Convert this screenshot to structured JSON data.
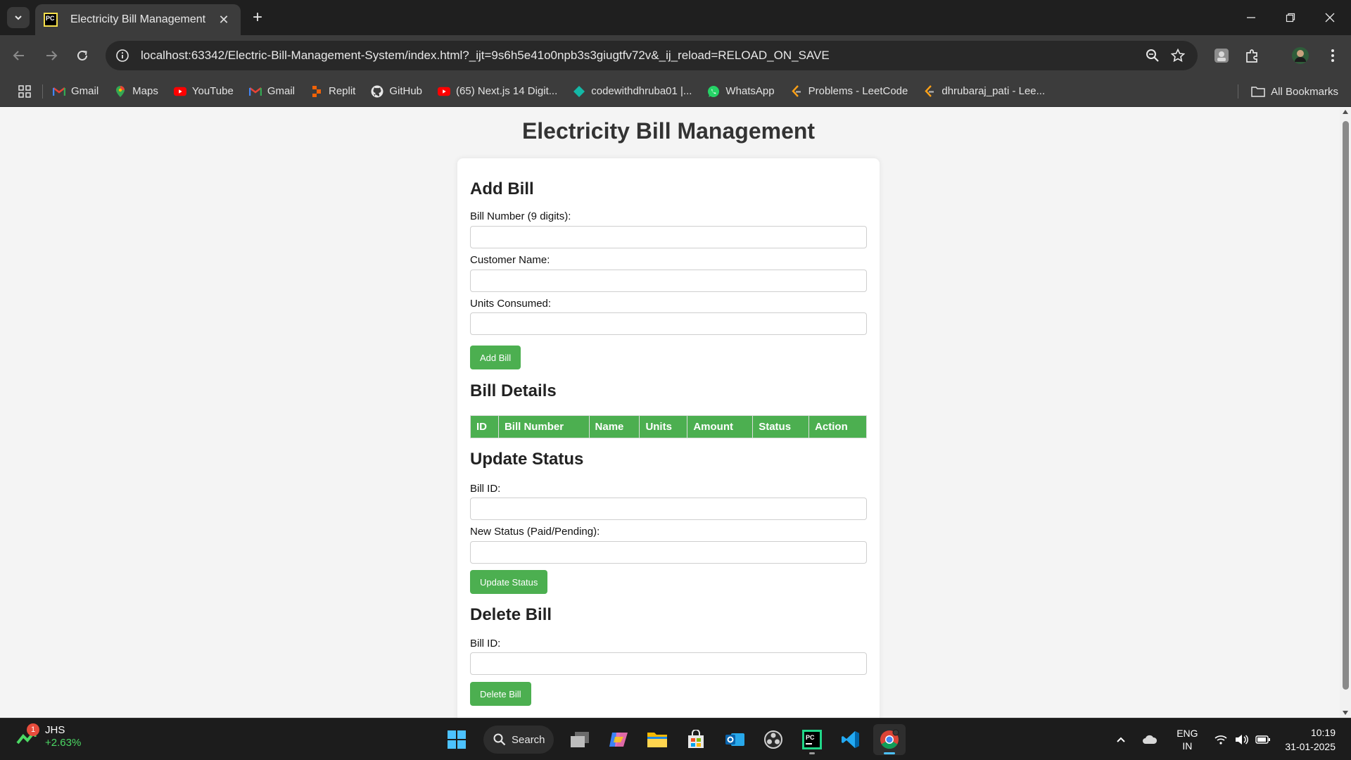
{
  "browser": {
    "tab_title": "Electricity Bill Management",
    "tab_favicon_text": "PC",
    "url": "localhost:63342/Electric-Bill-Management-System/index.html?_ijt=9s6h5e41o0npb3s3giugtfv72v&_ij_reload=RELOAD_ON_SAVE",
    "bookmarks": [
      {
        "label": "Gmail",
        "icon": "gmail-icon"
      },
      {
        "label": "Maps",
        "icon": "maps-icon"
      },
      {
        "label": "YouTube",
        "icon": "youtube-icon"
      },
      {
        "label": "Gmail",
        "icon": "gmail-icon"
      },
      {
        "label": "Replit",
        "icon": "replit-icon"
      },
      {
        "label": "GitHub",
        "icon": "github-icon"
      },
      {
        "label": "(65) Next.js 14 Digit...",
        "icon": "youtube-icon"
      },
      {
        "label": "codewithdhruba01 |...",
        "icon": "diamond-icon"
      },
      {
        "label": "WhatsApp",
        "icon": "whatsapp-icon"
      },
      {
        "label": "Problems - LeetCode",
        "icon": "leetcode-icon"
      },
      {
        "label": "dhrubaraj_pati - Lee...",
        "icon": "leetcode-icon"
      }
    ],
    "all_bookmarks": "All Bookmarks"
  },
  "page": {
    "title": "Electricity Bill Management",
    "add_bill": {
      "heading": "Add Bill",
      "bill_number_label": "Bill Number (9 digits):",
      "customer_name_label": "Customer Name:",
      "units_label": "Units Consumed:",
      "button": "Add Bill"
    },
    "bill_details": {
      "heading": "Bill Details",
      "columns": [
        "ID",
        "Bill Number",
        "Name",
        "Units",
        "Amount",
        "Status",
        "Action"
      ]
    },
    "update_status": {
      "heading": "Update Status",
      "bill_id_label": "Bill ID:",
      "new_status_label": "New Status (Paid/Pending):",
      "button": "Update Status"
    },
    "delete_bill": {
      "heading": "Delete Bill",
      "bill_id_label": "Bill ID:",
      "button": "Delete Bill"
    }
  },
  "taskbar": {
    "widget_badge": "1",
    "widget_name": "JHS",
    "widget_change": "+2.63%",
    "search_label": "Search",
    "lang_line1": "ENG",
    "lang_line2": "IN",
    "time": "10:19",
    "date": "31-01-2025"
  },
  "colors": {
    "accent_green": "#4caf50",
    "page_bg": "#f4f4f4",
    "chrome_dark": "#3c3c3c"
  }
}
